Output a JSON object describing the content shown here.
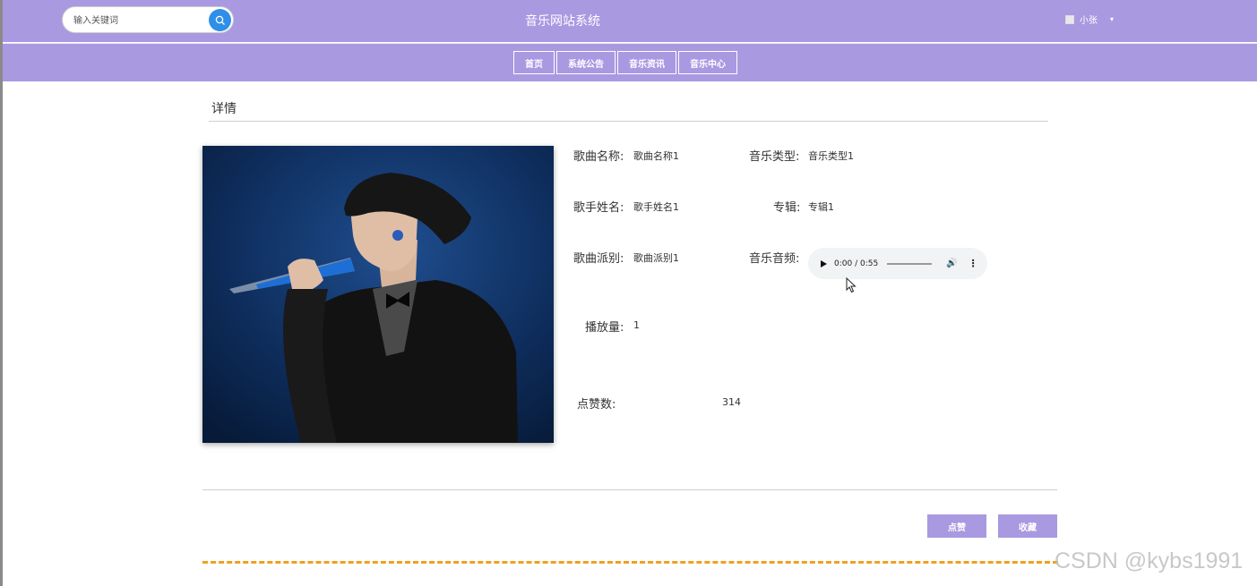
{
  "header": {
    "search_placeholder": "输入关键词",
    "site_title": "音乐网站系统",
    "user_name": "小张"
  },
  "nav": {
    "items": [
      "首页",
      "系统公告",
      "音乐资讯",
      "音乐中心"
    ]
  },
  "detail": {
    "section_title": "详情",
    "song_name_label": "歌曲名称:",
    "song_name": "歌曲名称1",
    "music_type_label": "音乐类型:",
    "music_type": "音乐类型1",
    "singer_label": "歌手姓名:",
    "singer": "歌手姓名1",
    "album_label": "专辑:",
    "album": "专辑1",
    "genre_label": "歌曲派别:",
    "genre": "歌曲派别1",
    "audio_label": "音乐音频:",
    "audio_time": "0:00 / 0:55",
    "plays_label": "播放量:",
    "plays": "1",
    "likes_label": "点赞数:",
    "likes": "314"
  },
  "actions": {
    "like_label": "点赞",
    "favorite_label": "收藏"
  },
  "watermark": "CSDN @kybs1991",
  "colors": {
    "header_bg": "#a999e1",
    "search_button": "#2f8fe8",
    "divider_dashed": "#f0a020"
  }
}
